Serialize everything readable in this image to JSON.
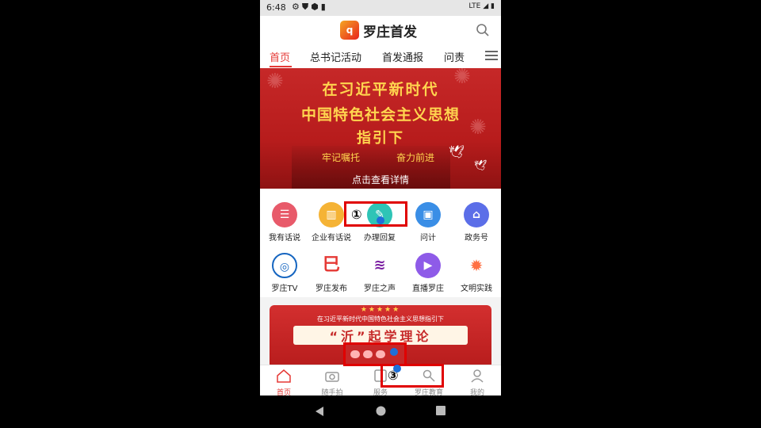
{
  "status_bar": {
    "time": "6:48",
    "network": "LTE"
  },
  "app": {
    "title": "罗庄首发",
    "logo_text": "q"
  },
  "tabs": [
    {
      "label": "首页",
      "active": true
    },
    {
      "label": "总书记活动"
    },
    {
      "label": "首发通报"
    },
    {
      "label": "问责"
    }
  ],
  "banner": {
    "line1": "在习近平新时代",
    "line2": "中国特色社会主义思想",
    "line3": "指引下",
    "slogan_left": "牢记嘱托",
    "slogan_right": "奋力前进",
    "detail_link": "点击查看详情"
  },
  "grid": [
    {
      "label": "我有话说",
      "icon": "chat-icon",
      "color": "#e85a6a"
    },
    {
      "label": "企业有话说",
      "icon": "building-icon",
      "color": "#f5b335"
    },
    {
      "label": "办理回复",
      "icon": "reply-icon",
      "color": "#2ec4b6"
    },
    {
      "label": "问计",
      "icon": "question-icon",
      "color": "#3a8ee6"
    },
    {
      "label": "政务号",
      "icon": "government-icon",
      "color": "#5b6ee8"
    },
    {
      "label": "罗庄TV",
      "icon": "tv-logo-icon",
      "color": "#1565c0"
    },
    {
      "label": "罗庄发布",
      "icon": "publish-logo-icon",
      "color": "#e53935"
    },
    {
      "label": "罗庄之声",
      "icon": "voice-logo-icon",
      "color": "#7b1fa2"
    },
    {
      "label": "直播罗庄",
      "icon": "live-icon",
      "color": "#8e5be8"
    },
    {
      "label": "文明实践",
      "icon": "civilization-logo-icon",
      "color": "#ff7043"
    }
  ],
  "card": {
    "stars": "★★★★★",
    "title": "在习近平新时代中国特色社会主义思想指引下",
    "headline": "“沂”起学理论"
  },
  "bottom_nav": [
    {
      "label": "首页",
      "icon": "home-icon",
      "active": true
    },
    {
      "label": "随手拍",
      "icon": "camera-icon"
    },
    {
      "label": "服务",
      "icon": "service-icon"
    },
    {
      "label": "罗庄教育",
      "icon": "education-icon"
    },
    {
      "label": "我的",
      "icon": "user-icon"
    }
  ],
  "annotations": [
    {
      "label": "①"
    },
    {
      "label": "③"
    }
  ],
  "colors": {
    "accent": "#e53935",
    "annotation": "#e00000"
  }
}
